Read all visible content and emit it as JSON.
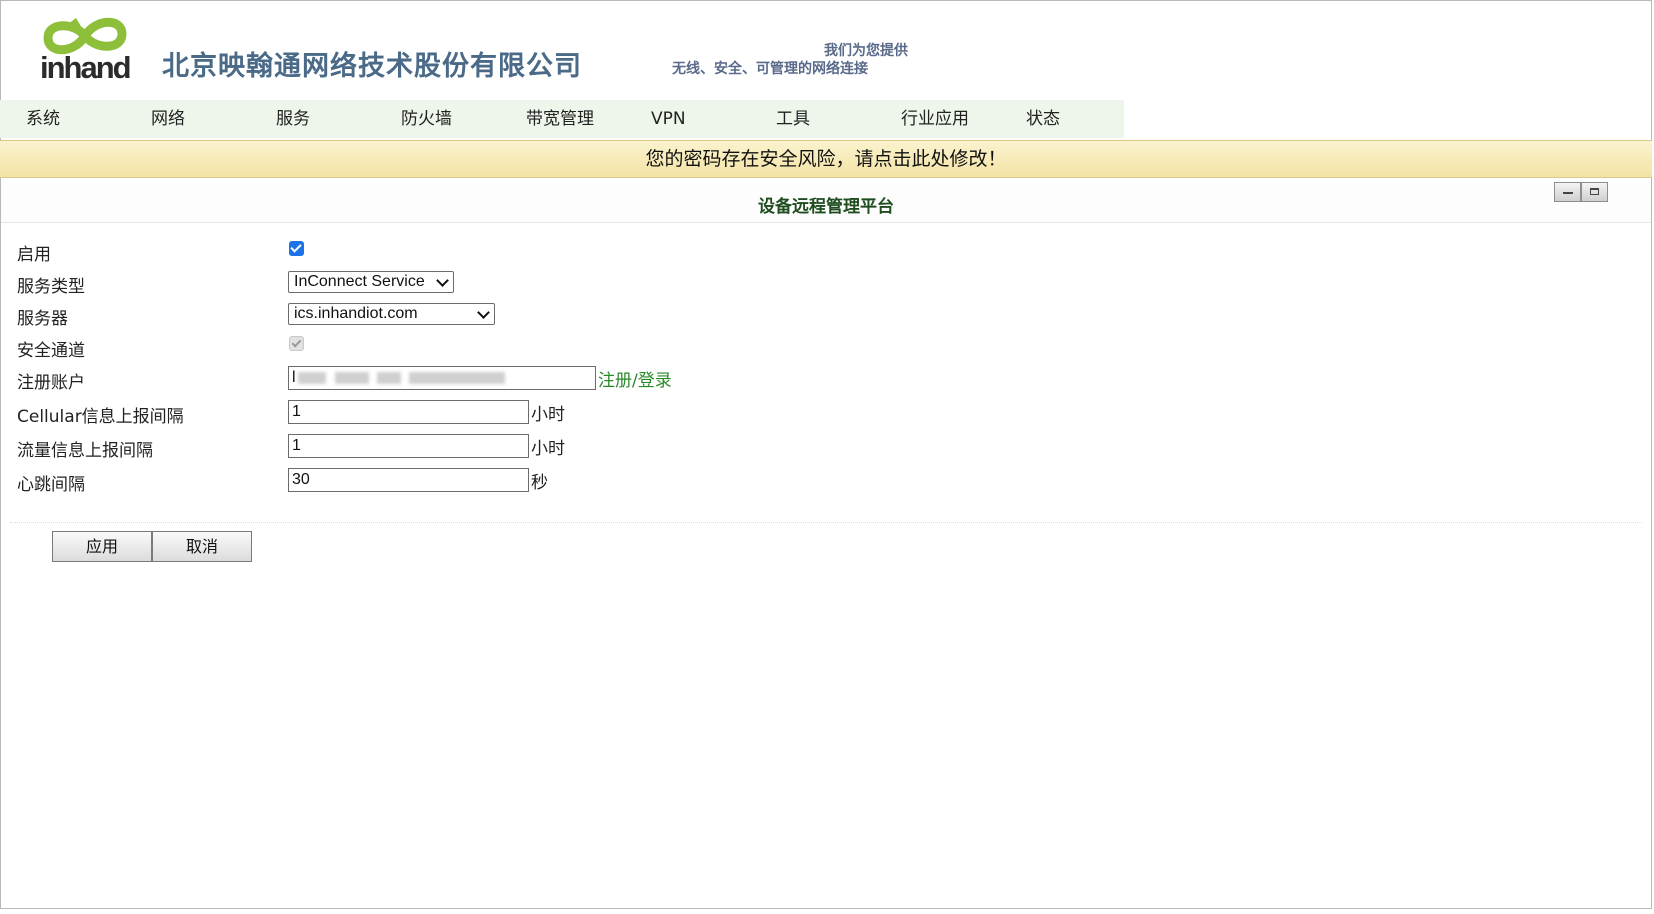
{
  "header": {
    "logo_text": "inhand",
    "company_name": "北京映翰通网络技术股份有限公司",
    "slogan_line1": "我们为您提供",
    "slogan_line2": "无线、安全、可管理的网络连接"
  },
  "nav": {
    "items": [
      "系统",
      "网络",
      "服务",
      "防火墙",
      "带宽管理",
      "VPN",
      "工具",
      "行业应用",
      "状态"
    ]
  },
  "warning": {
    "text": "您的密码存在安全风险，请点击此处修改！"
  },
  "panel": {
    "title": "设备远程管理平台"
  },
  "form": {
    "enable_label": "启用",
    "enable_checked": true,
    "service_type_label": "服务类型",
    "service_type_value": "InConnect Service",
    "server_label": "服务器",
    "server_value": "ics.inhandiot.com",
    "secure_channel_label": "安全通道",
    "secure_channel_checked": true,
    "secure_channel_disabled": true,
    "account_label": "注册账户",
    "account_value": "l",
    "register_link": "注册/登录",
    "cellular_label": "Cellular信息上报间隔",
    "cellular_value": "1",
    "cellular_unit": "小时",
    "traffic_label": "流量信息上报间隔",
    "traffic_value": "1",
    "traffic_unit": "小时",
    "heartbeat_label": "心跳间隔",
    "heartbeat_value": "30",
    "heartbeat_unit": "秒"
  },
  "buttons": {
    "apply": "应用",
    "cancel": "取消"
  },
  "colors": {
    "nav_bg": "#eef6ec",
    "warning_bg": "#f6e9b5",
    "title_color": "#1f4d1f",
    "link_color": "#2a8a2a",
    "checkbox_blue": "#1a73e8"
  }
}
